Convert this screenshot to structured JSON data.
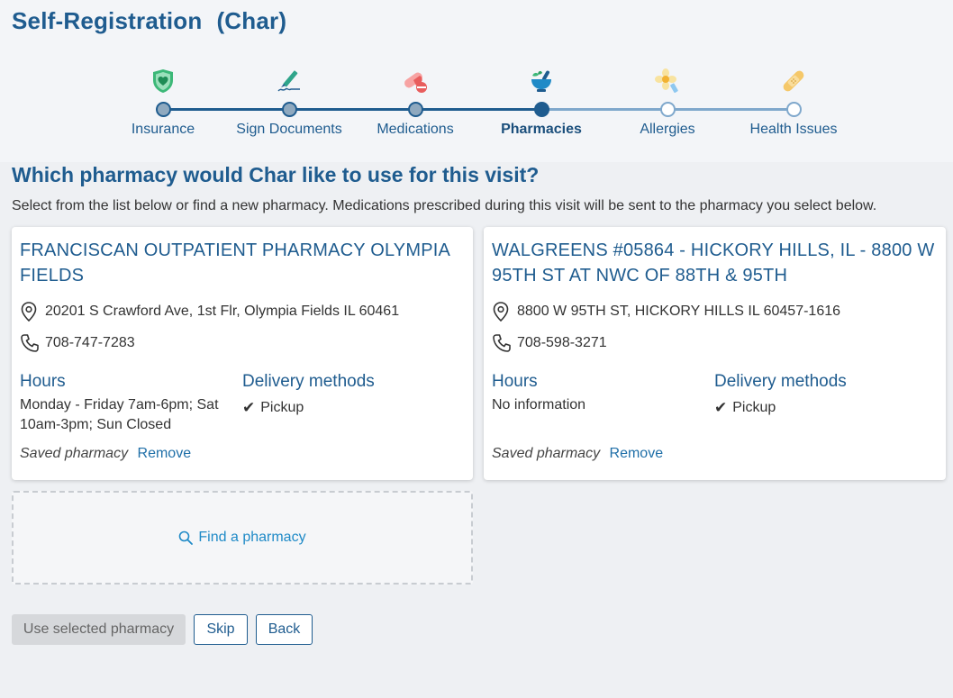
{
  "header": {
    "title": "Self-Registration",
    "patient": "(Char)"
  },
  "stepper": {
    "steps": [
      {
        "label": "Insurance",
        "state": "done",
        "icon": "shield-heart-icon"
      },
      {
        "label": "Sign Documents",
        "state": "done",
        "icon": "pen-signature-icon"
      },
      {
        "label": "Medications",
        "state": "done",
        "icon": "pill-icon"
      },
      {
        "label": "Pharmacies",
        "state": "current",
        "icon": "mortar-pestle-icon"
      },
      {
        "label": "Allergies",
        "state": "future",
        "icon": "flower-icon"
      },
      {
        "label": "Health Issues",
        "state": "future",
        "icon": "bandage-icon"
      }
    ],
    "colors": {
      "done": "#1f5c8f",
      "future": "#7fa8cc"
    }
  },
  "main": {
    "question": "Which pharmacy would Char like to use for this visit?",
    "instructions": "Select from the list below or find a new pharmacy. Medications prescribed during this visit will be sent to the pharmacy you select below."
  },
  "pharmacies": [
    {
      "name": "FRANCISCAN OUTPATIENT PHARMACY OLYMPIA FIELDS",
      "address": "20201 S Crawford Ave, 1st Flr, Olympia Fields IL 60461",
      "phone": "708-747-7283",
      "hours_label": "Hours",
      "hours": "Monday - Friday 7am-6pm; Sat 10am-3pm; Sun Closed",
      "delivery_label": "Delivery methods",
      "delivery": "Pickup",
      "saved": "Saved pharmacy",
      "remove": "Remove"
    },
    {
      "name": "WALGREENS #05864 - HICKORY HILLS, IL - 8800 W 95TH ST AT NWC OF 88TH & 95TH",
      "address": "8800 W 95TH ST, HICKORY HILLS IL 60457-1616",
      "phone": "708-598-3271",
      "hours_label": "Hours",
      "hours": "No information",
      "delivery_label": "Delivery methods",
      "delivery": "Pickup",
      "saved": "Saved pharmacy",
      "remove": "Remove"
    }
  ],
  "find": {
    "label": "Find a pharmacy"
  },
  "actions": {
    "use_selected": "Use selected pharmacy",
    "skip": "Skip",
    "back": "Back"
  }
}
